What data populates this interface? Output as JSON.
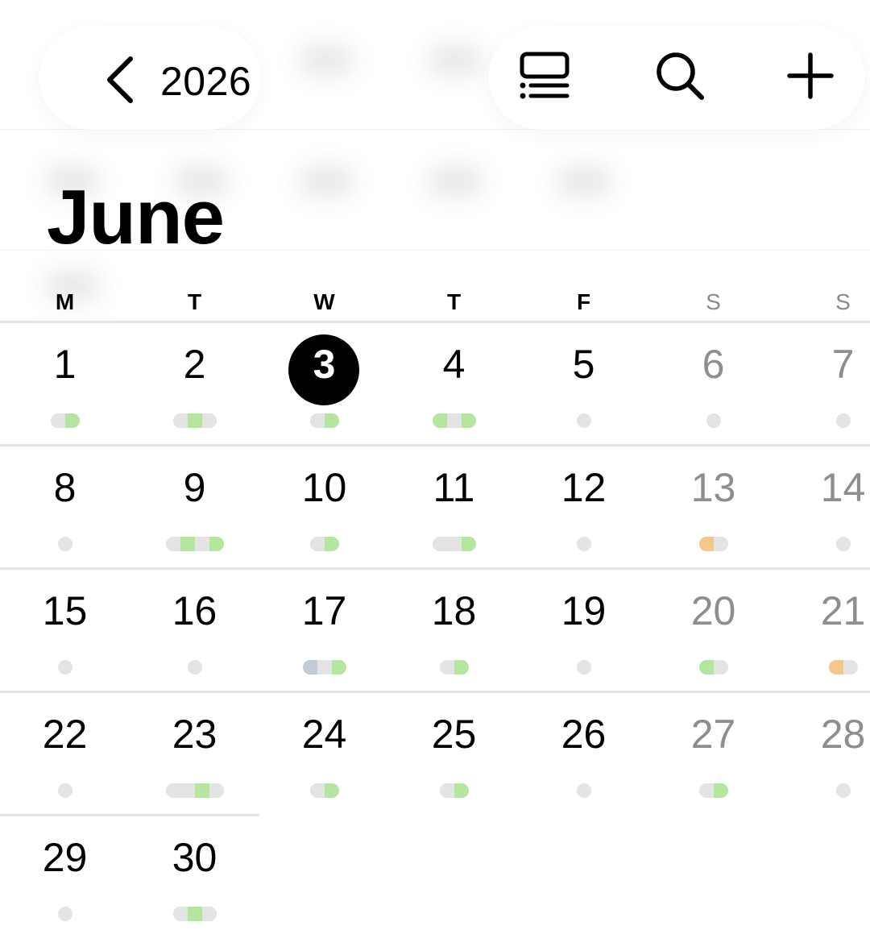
{
  "header": {
    "back_year": "2026",
    "icons": [
      "chevron-left-icon",
      "list-view-icon",
      "search-icon",
      "add-icon"
    ]
  },
  "month": {
    "title": "June"
  },
  "weekdays": [
    "M",
    "T",
    "W",
    "T",
    "F",
    "S",
    "S"
  ],
  "today": 3,
  "colors": {
    "event_green": "#b5e6a0",
    "event_orange": "#f3c98b",
    "event_blue": "#c2cbd8",
    "event_grey": "#e4e4e4",
    "today_circle": "#000000",
    "weekend_text": "#8e8e8e"
  },
  "weeks": [
    [
      {
        "day": "1",
        "events": [
          "grey",
          "green"
        ]
      },
      {
        "day": "2",
        "events": [
          "grey",
          "green",
          "grey"
        ]
      },
      {
        "day": "3",
        "events": [
          "grey",
          "green"
        ]
      },
      {
        "day": "4",
        "events": [
          "green",
          "grey",
          "green"
        ]
      },
      {
        "day": "5",
        "events": [
          "grey"
        ]
      },
      {
        "day": "6",
        "events": []
      },
      {
        "day": "7",
        "events": []
      }
    ],
    [
      {
        "day": "8",
        "events": [
          "grey"
        ]
      },
      {
        "day": "9",
        "events": [
          "grey",
          "green",
          "grey",
          "green"
        ]
      },
      {
        "day": "10",
        "events": [
          "grey",
          "green"
        ]
      },
      {
        "day": "11",
        "events": [
          "grey",
          "grey",
          "green"
        ]
      },
      {
        "day": "12",
        "events": [
          "grey"
        ]
      },
      {
        "day": "13",
        "events": [
          "orange",
          "grey"
        ]
      },
      {
        "day": "14",
        "events": []
      }
    ],
    [
      {
        "day": "15",
        "events": []
      },
      {
        "day": "16",
        "events": [
          "grey"
        ]
      },
      {
        "day": "17",
        "events": [
          "blue",
          "grey",
          "green"
        ]
      },
      {
        "day": "18",
        "events": [
          "grey",
          "green"
        ]
      },
      {
        "day": "19",
        "events": []
      },
      {
        "day": "20",
        "events": [
          "green",
          "grey"
        ]
      },
      {
        "day": "21",
        "events": [
          "orange",
          "grey"
        ]
      }
    ],
    [
      {
        "day": "22",
        "events": [
          "grey"
        ]
      },
      {
        "day": "23",
        "events": [
          "grey",
          "grey",
          "green",
          "grey"
        ]
      },
      {
        "day": "24",
        "events": [
          "grey",
          "green"
        ]
      },
      {
        "day": "25",
        "events": [
          "grey",
          "green"
        ]
      },
      {
        "day": "26",
        "events": []
      },
      {
        "day": "27",
        "events": [
          "grey",
          "green"
        ]
      },
      {
        "day": "28",
        "events": []
      }
    ],
    [
      {
        "day": "29",
        "events": []
      },
      {
        "day": "30",
        "events": [
          "grey",
          "green",
          "grey"
        ]
      }
    ]
  ]
}
